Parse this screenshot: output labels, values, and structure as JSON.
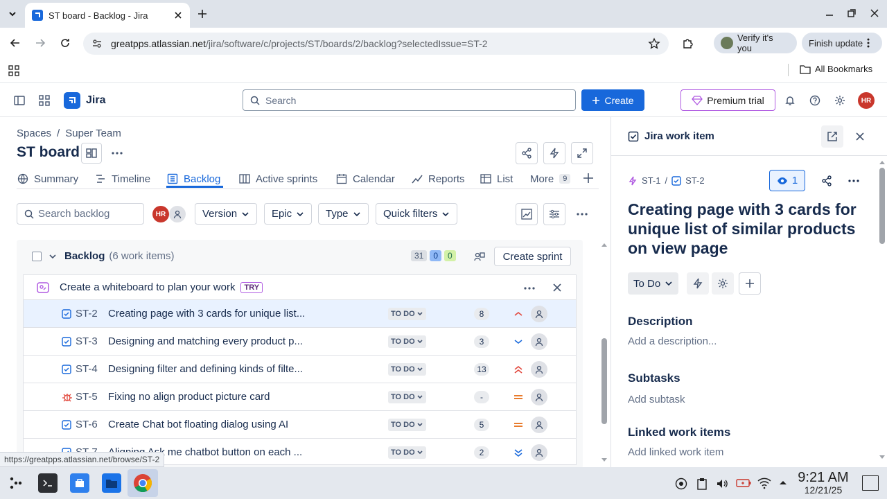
{
  "browser": {
    "tab_title": "ST board - Backlog - Jira",
    "url_host": "greatpps.atlassian.net",
    "url_path": "/jira/software/c/projects/ST/boards/2/backlog?selectedIssue=ST-2",
    "verify_label": "Verify it's you",
    "update_label": "Finish update",
    "bookmarks_label": "All Bookmarks",
    "status_url": "https://greatpps.atlassian.net/browse/ST-2"
  },
  "jira": {
    "product": "Jira",
    "search_placeholder": "Search",
    "create_label": "Create",
    "premium_label": "Premium trial",
    "user_initials": "HR"
  },
  "board": {
    "breadcrumb_spaces": "Spaces",
    "breadcrumb_sep": "/",
    "breadcrumb_team": "Super Team",
    "title": "ST board",
    "tabs": [
      {
        "label": "Summary"
      },
      {
        "label": "Timeline"
      },
      {
        "label": "Backlog"
      },
      {
        "label": "Active sprints"
      },
      {
        "label": "Calendar"
      },
      {
        "label": "Reports"
      },
      {
        "label": "List"
      },
      {
        "label": "More",
        "count": "9"
      }
    ],
    "search_backlog_placeholder": "Search backlog",
    "filters": {
      "version": "Version",
      "epic": "Epic",
      "type": "Type",
      "quick": "Quick filters"
    }
  },
  "backlog": {
    "title": "Backlog",
    "count_text": "(6 work items)",
    "todo_points": "31",
    "inprogress_points": "0",
    "done_points": "0",
    "create_sprint_label": "Create sprint",
    "whiteboard_text": "Create a whiteboard to plan your work",
    "whiteboard_badge": "TRY",
    "items": [
      {
        "key": "ST-2",
        "summary": "Creating page with 3 cards for unique list...",
        "status": "TO DO",
        "points": "8",
        "priority": "medium-high",
        "type": "task"
      },
      {
        "key": "ST-3",
        "summary": "Designing and matching every product p...",
        "status": "TO DO",
        "points": "3",
        "priority": "low",
        "type": "task"
      },
      {
        "key": "ST-4",
        "summary": "Designing filter and defining kinds of filte...",
        "status": "TO DO",
        "points": "13",
        "priority": "highest",
        "type": "task"
      },
      {
        "key": "ST-5",
        "summary": "Fixing no align product picture card",
        "status": "TO DO",
        "points": "-",
        "priority": "medium",
        "type": "bug"
      },
      {
        "key": "ST-6",
        "summary": "Create Chat bot floating dialog using AI",
        "status": "TO DO",
        "points": "5",
        "priority": "medium",
        "type": "task"
      },
      {
        "key": "ST-7",
        "summary": "Aligning Ask me chatbot button on each ...",
        "status": "TO DO",
        "points": "2",
        "priority": "lowest",
        "type": "task"
      }
    ]
  },
  "panel": {
    "header": "Jira work item",
    "parent_key": "ST-1",
    "sep": "/",
    "item_key": "ST-2",
    "watchers": "1",
    "title": "Creating page with 3 cards for unique list of similar products on view page",
    "status": "To Do",
    "description_label": "Description",
    "description_placeholder": "Add a description...",
    "subtasks_label": "Subtasks",
    "subtasks_placeholder": "Add subtask",
    "linked_label": "Linked work items",
    "linked_placeholder": "Add linked work item"
  },
  "taskbar": {
    "time": "9:21 AM",
    "date": "12/21/25"
  },
  "colors": {
    "brand": "#1868db",
    "avatar": "#c9372c",
    "priority_high": "#e2483d",
    "priority_medium": "#e56910",
    "priority_low": "#1868db"
  }
}
